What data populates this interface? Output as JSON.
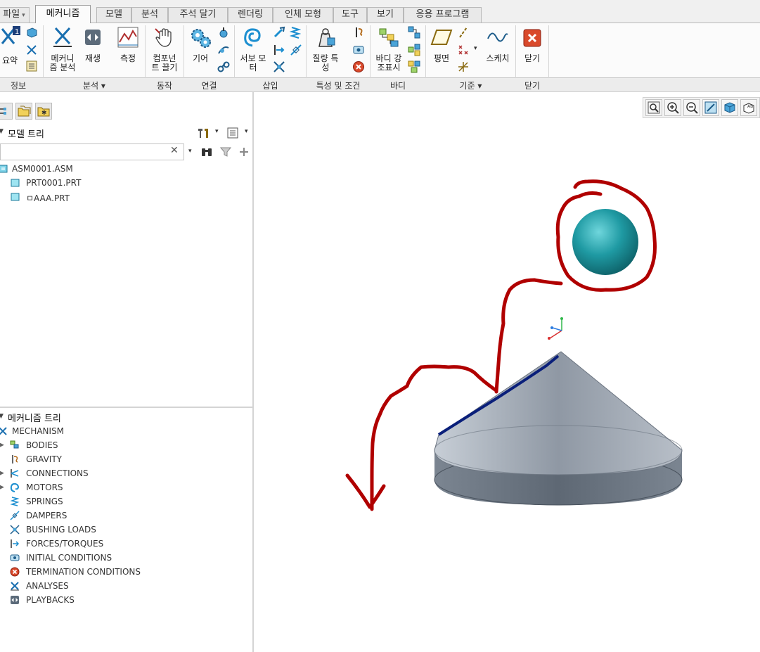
{
  "tabs": [
    {
      "label": "파일",
      "has_dropdown": true
    },
    {
      "label": "메커니즘",
      "active": true
    },
    {
      "label": "모델"
    },
    {
      "label": "분석"
    },
    {
      "label": "주석 달기"
    },
    {
      "label": "렌더링"
    },
    {
      "label": "인체 모형"
    },
    {
      "label": "도구"
    },
    {
      "label": "보기"
    },
    {
      "label": "응용 프로그램"
    }
  ],
  "ribbon": {
    "summary": "요약",
    "mech_analysis_l1": "메커니",
    "mech_analysis_l2": "즘 분석",
    "playback": "재생",
    "measure": "측정",
    "drag_l1": "컴포넌",
    "drag_l2": "트 끌기",
    "gear": "기어",
    "servo_l1": "서보 모",
    "servo_l2": "터",
    "mass_l1": "질량 특",
    "mass_l2": "성",
    "body_l1": "바디 강",
    "body_l2": "조표시",
    "plane": "평면",
    "sketch": "스케치",
    "close": "닫기"
  },
  "groups": {
    "info": "정보",
    "analysis": "분석 ▾",
    "motion": "동작",
    "connect": "연결",
    "insert": "삽입",
    "props": "특성 및 조건",
    "body": "바디",
    "datum": "기준 ▾",
    "close": "닫기"
  },
  "model_tree": {
    "title": "모델 트리",
    "search_value": "",
    "items": [
      {
        "label": "ASM0001.ASM",
        "level": 0,
        "icon": "assembly-icon"
      },
      {
        "label": "PRT0001.PRT",
        "level": 1,
        "icon": "part-icon"
      },
      {
        "label": "ㅁAAA.PRT",
        "level": 1,
        "icon": "part-icon"
      }
    ]
  },
  "mech_tree": {
    "title": "메커니즘 트리",
    "root": "MECHANISM",
    "items": [
      {
        "label": "BODIES",
        "expandable": true,
        "icon": "bodies-icon"
      },
      {
        "label": "GRAVITY",
        "expandable": false,
        "icon": "gravity-icon"
      },
      {
        "label": "CONNECTIONS",
        "expandable": true,
        "icon": "connections-icon"
      },
      {
        "label": "MOTORS",
        "expandable": true,
        "icon": "motors-icon"
      },
      {
        "label": "SPRINGS",
        "expandable": false,
        "icon": "springs-icon"
      },
      {
        "label": "DAMPERS",
        "expandable": false,
        "icon": "dampers-icon"
      },
      {
        "label": "BUSHING LOADS",
        "expandable": false,
        "icon": "bushing-icon"
      },
      {
        "label": "FORCES/TORQUES",
        "expandable": false,
        "icon": "forces-icon"
      },
      {
        "label": "INITIAL CONDITIONS",
        "expandable": false,
        "icon": "initial-conditions-icon"
      },
      {
        "label": "TERMINATION CONDITIONS",
        "expandable": false,
        "icon": "termination-icon"
      },
      {
        "label": "ANALYSES",
        "expandable": false,
        "icon": "analyses-icon"
      },
      {
        "label": "PLAYBACKS",
        "expandable": false,
        "icon": "playbacks-icon"
      }
    ]
  },
  "colors": {
    "accent": "#1a6fb0",
    "annotation": "#b00000",
    "sphere": "#1f9aa3",
    "cone": "#9ea7b3"
  }
}
